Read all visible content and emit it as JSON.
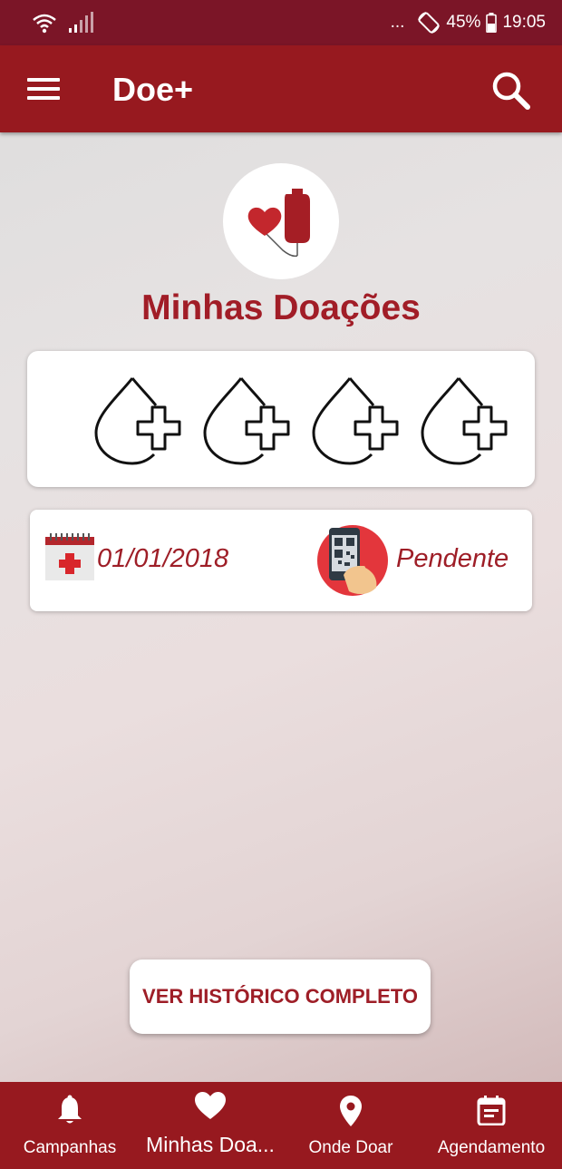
{
  "status_bar": {
    "dots": "...",
    "battery": "45%",
    "time": "19:05",
    "icons": [
      "wifi-icon",
      "signal-icon",
      "rotate-icon",
      "battery-icon"
    ]
  },
  "app_bar": {
    "title": "Doe+",
    "icons": [
      "menu-icon",
      "search-icon"
    ]
  },
  "main": {
    "logo_icon": "blood-bag-heart-icon",
    "title": "Minhas Doações",
    "drops": [
      "blood-drop-plus-icon",
      "blood-drop-plus-icon",
      "blood-drop-plus-icon",
      "blood-drop-plus-icon"
    ],
    "donation": {
      "date": "01/01/2018",
      "status": "Pendente",
      "date_icon": "calendar-cross-icon",
      "status_icon": "qr-phone-icon"
    },
    "history_button": "VER HISTÓRICO COMPLETO"
  },
  "bottom_nav": {
    "items": [
      {
        "label": "Campanhas",
        "icon": "bell-icon",
        "active": false
      },
      {
        "label": "Minhas Doa...",
        "icon": "heart-icon",
        "active": true
      },
      {
        "label": "Onde Doar",
        "icon": "location-pin-icon",
        "active": false
      },
      {
        "label": "Agendamento",
        "icon": "calendar-icon",
        "active": false
      }
    ]
  },
  "colors": {
    "primary": "#97191f",
    "status_bar": "#7b1527",
    "accent_text": "#a11d27",
    "heart": "#c3272d"
  }
}
